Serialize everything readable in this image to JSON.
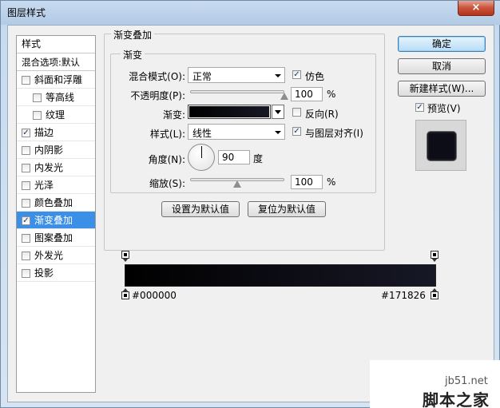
{
  "window": {
    "title": "图层样式",
    "close_label": "×"
  },
  "style_list": {
    "header": "样式",
    "blend_options": "混合选项:默认",
    "items": [
      {
        "label": "斜面和浮雕",
        "checked": false,
        "indent": false,
        "selected": false
      },
      {
        "label": "等高线",
        "checked": false,
        "indent": true,
        "selected": false
      },
      {
        "label": "纹理",
        "checked": false,
        "indent": true,
        "selected": false
      },
      {
        "label": "描边",
        "checked": true,
        "indent": false,
        "selected": false
      },
      {
        "label": "内阴影",
        "checked": false,
        "indent": false,
        "selected": false
      },
      {
        "label": "内发光",
        "checked": false,
        "indent": false,
        "selected": false
      },
      {
        "label": "光泽",
        "checked": false,
        "indent": false,
        "selected": false
      },
      {
        "label": "颜色叠加",
        "checked": false,
        "indent": false,
        "selected": false
      },
      {
        "label": "渐变叠加",
        "checked": true,
        "indent": false,
        "selected": true
      },
      {
        "label": "图案叠加",
        "checked": false,
        "indent": false,
        "selected": false
      },
      {
        "label": "外发光",
        "checked": false,
        "indent": false,
        "selected": false
      },
      {
        "label": "投影",
        "checked": false,
        "indent": false,
        "selected": false
      }
    ]
  },
  "panel": {
    "outer_title": "渐变叠加",
    "inner_title": "渐变",
    "blend_mode_label": "混合模式(O):",
    "blend_mode_value": "正常",
    "dither_label": "仿色",
    "dither_checked": true,
    "opacity_label": "不透明度(P):",
    "opacity_value": "100",
    "opacity_percent": 1.0,
    "percent_unit": "%",
    "gradient_label": "渐变:",
    "reverse_label": "反向(R)",
    "reverse_checked": false,
    "style_label": "样式(L):",
    "style_value": "线性",
    "align_label": "与图层对齐(I)",
    "align_checked": true,
    "angle_label": "角度(N):",
    "angle_value": "90",
    "angle_unit": "度",
    "scale_label": "缩放(S):",
    "scale_value": "100",
    "scale_fraction": 0.5,
    "make_default": "设置为默认值",
    "reset_default": "复位为默认值"
  },
  "buttons": {
    "ok": "确定",
    "cancel": "取消",
    "new_style": "新建样式(W)...",
    "preview_label": "预览(V)",
    "preview_checked": true
  },
  "gradient_editor": {
    "left_color": "#000000",
    "right_color": "#171826",
    "left_hex_label": "#000000",
    "right_hex_label": "#171826"
  },
  "watermark": {
    "url": "jb51.net",
    "name": "脚本之家"
  },
  "colors": {
    "selection": "#3b8fe6",
    "accent_button": "#b7dcf6"
  }
}
